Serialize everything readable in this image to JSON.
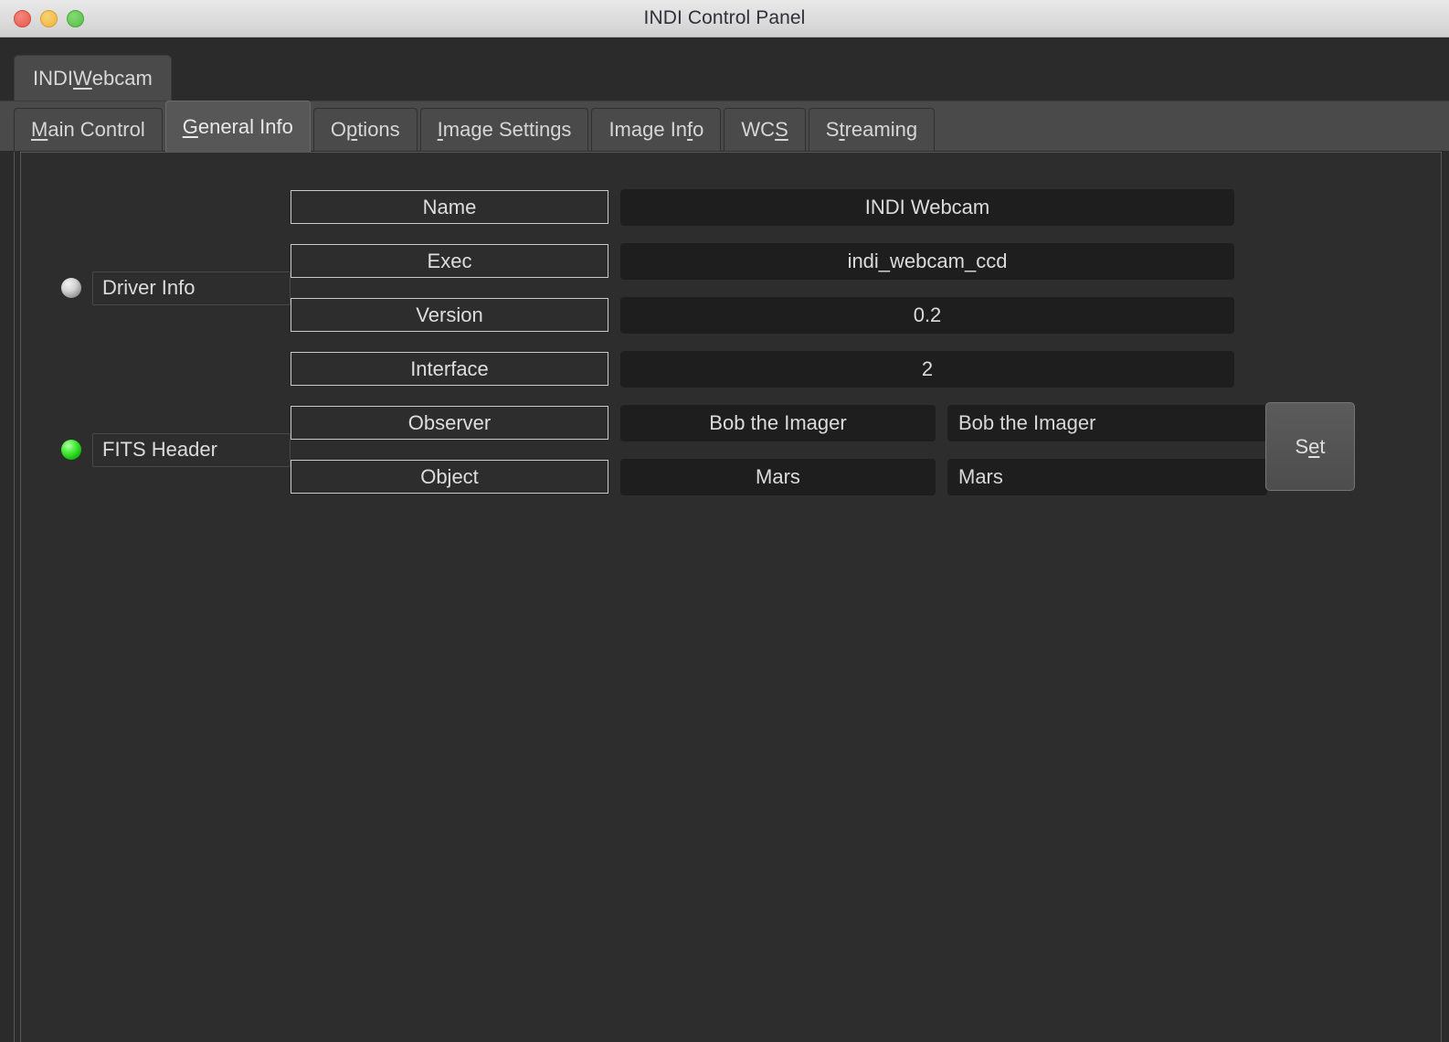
{
  "window": {
    "title": "INDI Control Panel",
    "traffic_lights": [
      {
        "name": "close",
        "color": "#ec6a5e"
      },
      {
        "name": "minimize",
        "color": "#f4bd4f"
      },
      {
        "name": "zoom",
        "color": "#61c554"
      }
    ]
  },
  "device_tabs": [
    {
      "label_before": "INDI ",
      "mnemonic": "W",
      "label_after": "ebcam",
      "selected": true
    }
  ],
  "property_tabs": [
    {
      "label_before": "",
      "mnemonic": "M",
      "label_after": "ain Control",
      "selected": false
    },
    {
      "label_before": "",
      "mnemonic": "G",
      "label_after": "eneral Info",
      "selected": true
    },
    {
      "label_before": "O",
      "mnemonic": "p",
      "label_after": "tions",
      "selected": false
    },
    {
      "label_before": "",
      "mnemonic": "I",
      "label_after": "mage Settings",
      "selected": false
    },
    {
      "label_before": "Image In",
      "mnemonic": "f",
      "label_after": "o",
      "selected": false
    },
    {
      "label_before": "WC",
      "mnemonic": "S",
      "label_after": "",
      "selected": false
    },
    {
      "label_before": "S",
      "mnemonic": "t",
      "label_after": "reaming",
      "selected": false
    }
  ],
  "groups": [
    {
      "name": "Driver Info",
      "led_state": "idle",
      "led_color": "#c8c8c8",
      "rows": [
        {
          "label": "Name",
          "value": "INDI Webcam",
          "editable": false
        },
        {
          "label": "Exec",
          "value": "indi_webcam_ccd",
          "editable": false
        },
        {
          "label": "Version",
          "value": "0.2",
          "editable": false
        },
        {
          "label": "Interface",
          "value": "2",
          "editable": false
        }
      ]
    },
    {
      "name": "FITS Header",
      "led_state": "ok",
      "led_color": "#22c40f",
      "set_button_before": "S",
      "set_button_mnemonic": "e",
      "set_button_after": "t",
      "set_button_label": "Set",
      "rows": [
        {
          "label": "Observer",
          "value": "Bob the Imager",
          "input": "Bob the Imager",
          "placeholder": "",
          "editable": true
        },
        {
          "label": "Object",
          "value": "Mars",
          "input": "Mars",
          "placeholder": "",
          "editable": true
        }
      ]
    }
  ]
}
